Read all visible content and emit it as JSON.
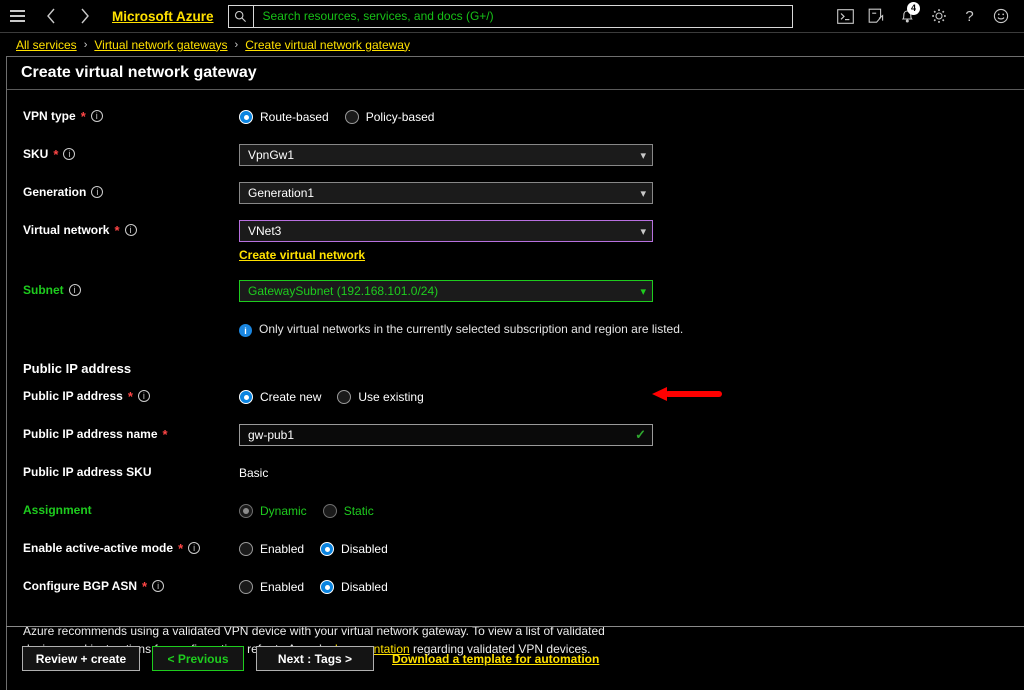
{
  "topbar": {
    "menu_icon": "hamburger-icon",
    "back_icon": "chevron-left-icon",
    "forward_icon": "chevron-right-icon",
    "brand": "Microsoft Azure",
    "search_placeholder": "Search resources, services, and docs (G+/)",
    "search_value": "",
    "search_icon": "search-icon",
    "actions": [
      {
        "name": "cloud-shell-icon",
        "glyph": "≥_"
      },
      {
        "name": "feedback-icon",
        "glyph": "✐"
      },
      {
        "name": "notifications-bell-icon",
        "glyph": "ὑ4",
        "badge": "4"
      },
      {
        "name": "settings-gear-icon",
        "glyph": "⚙"
      },
      {
        "name": "help-icon",
        "glyph": "?"
      },
      {
        "name": "feedback-smiley-icon",
        "glyph": "☺"
      }
    ]
  },
  "breadcrumb": {
    "items": [
      "All services",
      "Virtual network gateways",
      "Create virtual network gateway"
    ],
    "separator": "›"
  },
  "blade": {
    "title": "Create virtual network gateway"
  },
  "form": {
    "vpn_type": {
      "label": "VPN type",
      "required": "*",
      "options": [
        "Route-based",
        "Policy-based"
      ],
      "selected": "Route-based"
    },
    "sku": {
      "label": "SKU",
      "required": "*",
      "value": "VpnGw1"
    },
    "generation": {
      "label": "Generation",
      "value": "Generation1"
    },
    "virtual_network": {
      "label": "Virtual network",
      "required": "*",
      "value": "VNet3",
      "create_link": "Create virtual network"
    },
    "subnet": {
      "label": "Subnet",
      "value": "GatewaySubnet (192.168.101.0/24)"
    },
    "vnet_note": "Only virtual networks in the currently selected subscription and region are listed.",
    "public_ip_section": "Public IP address",
    "public_ip_address": {
      "label": "Public IP address",
      "required": "*",
      "options": [
        "Create new",
        "Use existing"
      ],
      "selected": "Create new"
    },
    "public_ip_name": {
      "label": "Public IP address name",
      "required": "*",
      "value": "gw-pub1",
      "valid_icon": "checkmark-icon"
    },
    "public_ip_sku": {
      "label": "Public IP address SKU",
      "value": "Basic"
    },
    "assignment": {
      "label": "Assignment",
      "options": [
        "Dynamic",
        "Static"
      ],
      "selected": "Dynamic"
    },
    "active_active": {
      "label": "Enable active-active mode",
      "required": "*",
      "options": [
        "Enabled",
        "Disabled"
      ],
      "selected": "Disabled"
    },
    "bgp_asn": {
      "label": "Configure BGP ASN",
      "required": "*",
      "options": [
        "Enabled",
        "Disabled"
      ],
      "selected": "Disabled"
    },
    "disclaimer": {
      "before": "Azure recommends using a validated VPN device with your virtual network gateway. To view a list of validated devices and instructions for configuration, refer to Azure’s ",
      "link": "documentation",
      "after": " regarding validated VPN devices."
    }
  },
  "annotation": {
    "arrow": "red-left-arrow",
    "color": "#ff0000"
  },
  "footer": {
    "review_create": "Review + create",
    "previous": "< Previous",
    "next": "Next : Tags >",
    "download_template": "Download a template for automation"
  },
  "colors": {
    "link_yellow": "#ffe100",
    "green": "#1ecc1e",
    "accent_blue": "#0a84e0",
    "required_red": "#ff4646",
    "purple_border": "#b86fe0"
  }
}
